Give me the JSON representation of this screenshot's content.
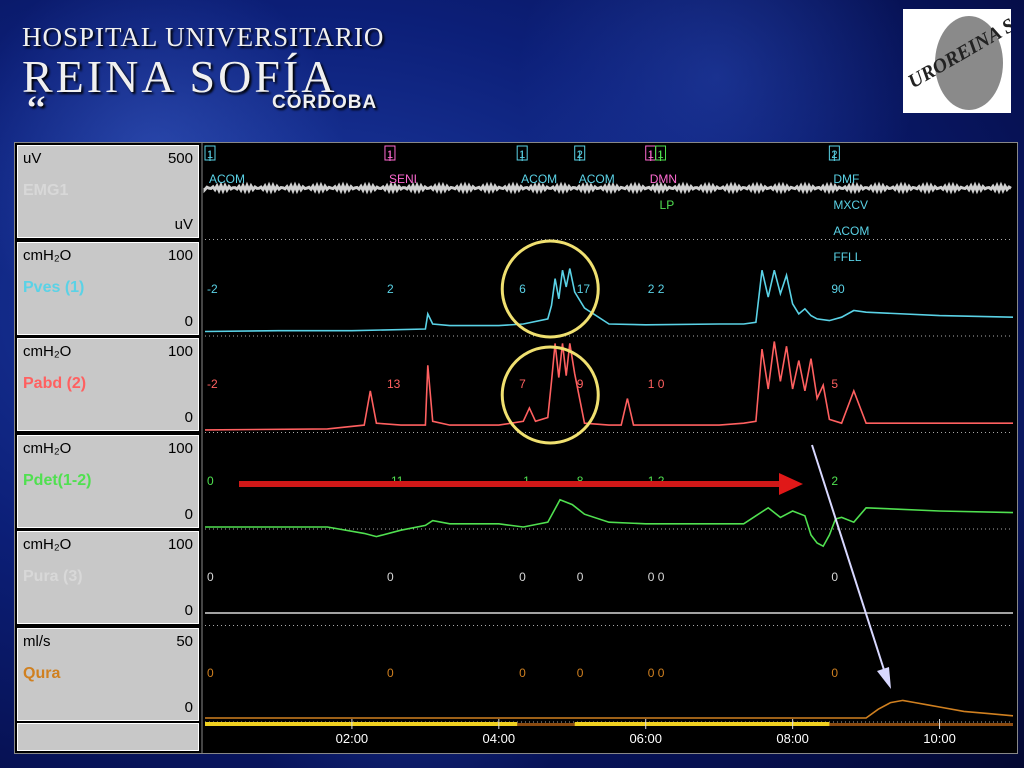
{
  "header": {
    "line1": "HOSPITAL UNIVERSITARIO",
    "line2": "REINA SOFÍA",
    "line3": "CÓRDOBA",
    "quote": "‘‘"
  },
  "logo": {
    "text": "UROREINA SOFÍA"
  },
  "channels": [
    {
      "unit": "uV",
      "max": "500",
      "name": "EMG1",
      "min": "uV",
      "color": "#d8d8d8"
    },
    {
      "unit": "cmH₂O",
      "max": "100",
      "name": "Pves (1)",
      "min": "0",
      "color": "#5ad2e6"
    },
    {
      "unit": "cmH₂O",
      "max": "100",
      "name": "Pabd (2)",
      "min": "0",
      "color": "#ff6060"
    },
    {
      "unit": "cmH₂O",
      "max": "100",
      "name": "Pdet(1-2)",
      "min": "0",
      "color": "#50e050"
    },
    {
      "unit": "cmH₂O",
      "max": "100",
      "name": "Pura (3)",
      "min": "0",
      "color": "#d8d8d8"
    },
    {
      "unit": "ml/s",
      "max": "50",
      "name": "Qura",
      "min": "0",
      "color": "#d08020"
    }
  ],
  "chart_data": {
    "type": "line",
    "xlabel": "",
    "x_ticks": [
      "02:00",
      "04:00",
      "06:00",
      "08:00",
      "10:00"
    ],
    "x_tick_values": [
      120,
      240,
      360,
      480,
      600
    ],
    "xlim": [
      0,
      660
    ],
    "events": [
      {
        "t": 0,
        "num": "1",
        "label": "ACOM",
        "color": "#5ad2e6"
      },
      {
        "t": 147,
        "num": "1",
        "label": "SENI",
        "color": "#ff6ad2"
      },
      {
        "t": 255,
        "num": "1",
        "label": "ACOM",
        "color": "#5ad2e6"
      },
      {
        "t": 302,
        "num": "2",
        "label": "ACOM",
        "color": "#5ad2e6"
      },
      {
        "t": 360,
        "num": "1",
        "label": "DMN",
        "color": "#ff6ad2"
      },
      {
        "t": 368,
        "num": "1",
        "label": "LP",
        "color": "#50e050"
      },
      {
        "t": 510,
        "num": "2",
        "label": "DMF",
        "color": "#5ad2e6"
      }
    ],
    "event_extra_labels": [
      "MXCV",
      "ACOM",
      "FFLL"
    ],
    "value_labels": {
      "Pves": [
        [
          "-2",
          0
        ],
        [
          "2",
          147
        ],
        [
          "6",
          255
        ],
        [
          "17",
          302
        ],
        [
          "2 2",
          360
        ],
        [
          "90",
          510
        ]
      ],
      "Pabd": [
        [
          "-2",
          0
        ],
        [
          "13",
          147
        ],
        [
          "7",
          255
        ],
        [
          "9",
          302
        ],
        [
          "1 0",
          360
        ],
        [
          "5",
          510
        ]
      ],
      "Pdet": [
        [
          "0",
          0
        ],
        [
          "-11",
          147
        ],
        [
          "-1",
          255
        ],
        [
          "8",
          302
        ],
        [
          "1 2",
          360
        ],
        [
          "2",
          510
        ]
      ],
      "Pura": [
        [
          "0",
          0
        ],
        [
          "0",
          147
        ],
        [
          "0",
          255
        ],
        [
          "0",
          302
        ],
        [
          "0 0",
          360
        ],
        [
          "0",
          510
        ]
      ],
      "Qura": [
        [
          "0",
          0
        ],
        [
          "0",
          147
        ],
        [
          "0",
          255
        ],
        [
          "0",
          302
        ],
        [
          "0 0",
          360
        ],
        [
          "0",
          510
        ]
      ]
    },
    "series": [
      {
        "name": "Pves (1)",
        "t": [
          0,
          60,
          120,
          180,
          182,
          186,
          200,
          240,
          260,
          280,
          283,
          286,
          289,
          292,
          295,
          298,
          302,
          310,
          330,
          360,
          420,
          440,
          450,
          455,
          460,
          465,
          470,
          475,
          480,
          485,
          490,
          495,
          500,
          510,
          520,
          530,
          540,
          600,
          660
        ],
        "values": [
          -3,
          -2,
          -2,
          0,
          18,
          6,
          4,
          4,
          6,
          12,
          28,
          60,
          36,
          70,
          50,
          72,
          44,
          25,
          6,
          5,
          6,
          6,
          8,
          70,
          38,
          70,
          42,
          64,
          30,
          18,
          24,
          16,
          12,
          10,
          14,
          22,
          20,
          16,
          14
        ]
      },
      {
        "name": "Pabd (2)",
        "t": [
          0,
          100,
          130,
          135,
          140,
          160,
          180,
          182,
          186,
          200,
          240,
          260,
          265,
          270,
          280,
          283,
          286,
          289,
          292,
          295,
          298,
          302,
          310,
          330,
          340,
          345,
          350,
          360,
          420,
          440,
          450,
          455,
          460,
          465,
          470,
          475,
          480,
          485,
          490,
          495,
          500,
          505,
          510,
          520,
          530,
          540,
          600,
          660
        ],
        "values": [
          -3,
          -2,
          2,
          38,
          4,
          2,
          2,
          65,
          6,
          2,
          2,
          6,
          20,
          6,
          10,
          48,
          88,
          52,
          88,
          54,
          88,
          56,
          4,
          2,
          2,
          30,
          2,
          2,
          2,
          4,
          6,
          82,
          40,
          90,
          48,
          85,
          40,
          70,
          38,
          72,
          30,
          44,
          8,
          4,
          38,
          4,
          4,
          4
        ]
      },
      {
        "name": "Pdet(1-2)",
        "t": [
          0,
          100,
          130,
          140,
          160,
          180,
          186,
          200,
          240,
          260,
          280,
          290,
          300,
          310,
          330,
          360,
          420,
          440,
          450,
          460,
          470,
          480,
          490,
          495,
          500,
          505,
          510,
          515,
          520,
          530,
          540,
          600,
          660
        ],
        "values": [
          0,
          0,
          -8,
          -12,
          -4,
          2,
          8,
          4,
          4,
          0,
          6,
          34,
          28,
          16,
          6,
          4,
          4,
          4,
          14,
          24,
          12,
          20,
          14,
          -10,
          -20,
          -24,
          -10,
          10,
          12,
          6,
          24,
          20,
          18
        ]
      },
      {
        "name": "Pura (3)",
        "t": [
          0,
          660
        ],
        "values": [
          0,
          0
        ]
      },
      {
        "name": "Qura",
        "t": [
          0,
          540,
          550,
          560,
          570,
          580,
          590,
          600,
          620,
          640,
          660
        ],
        "values": [
          0,
          0,
          4,
          7,
          8,
          7,
          6,
          5,
          3,
          2,
          1
        ]
      }
    ]
  }
}
